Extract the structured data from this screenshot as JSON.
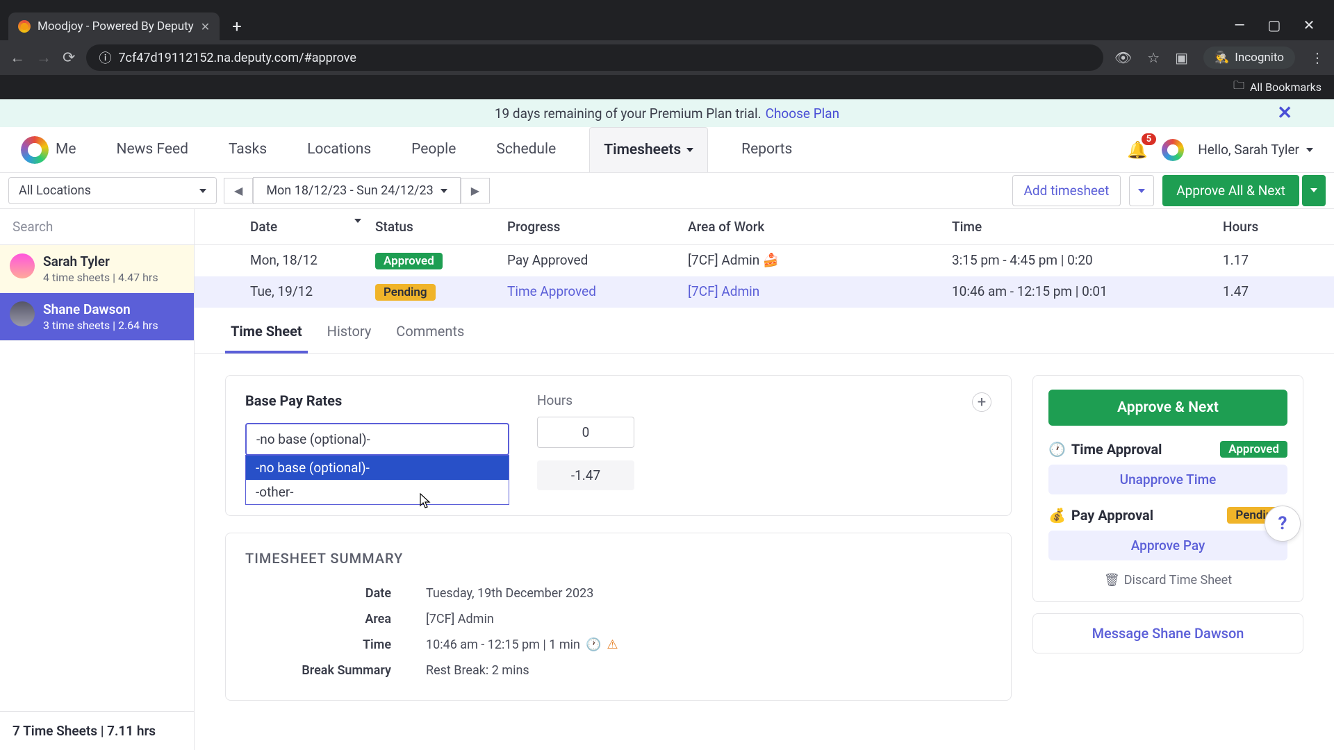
{
  "browser": {
    "tab_title": "Moodjoy - Powered By Deputy",
    "url": "7cf47d19112152.na.deputy.com/#approve",
    "incognito_label": "Incognito",
    "all_bookmarks": "All Bookmarks"
  },
  "banner": {
    "text": "19 days remaining of your Premium Plan trial.",
    "link": "Choose Plan"
  },
  "nav": {
    "items": [
      "Me",
      "News Feed",
      "Tasks",
      "Locations",
      "People",
      "Schedule",
      "Timesheets",
      "Reports"
    ],
    "active": "Timesheets",
    "notif_count": "5",
    "greeting": "Hello, Sarah Tyler"
  },
  "toolbar": {
    "location": "All Locations",
    "date_range": "Mon 18/12/23 - Sun 24/12/23",
    "add_timesheet": "Add timesheet",
    "approve_all": "Approve All & Next"
  },
  "sidebar": {
    "search_placeholder": "Search",
    "employees": [
      {
        "name": "Sarah Tyler",
        "meta": "4 time sheets | 4.47 hrs"
      },
      {
        "name": "Shane Dawson",
        "meta": "3 time sheets | 2.64 hrs"
      }
    ],
    "footer": "7 Time Sheets | 7.11 hrs"
  },
  "table": {
    "headers": {
      "date": "Date",
      "status": "Status",
      "progress": "Progress",
      "area": "Area of Work",
      "time": "Time",
      "hours": "Hours"
    },
    "rows": [
      {
        "date": "Mon, 18/12",
        "status": "Approved",
        "progress": "Pay Approved",
        "area": "[7CF] Admin 🍰",
        "time": "3:15 pm - 4:45 pm | 0:20",
        "hours": "1.17"
      },
      {
        "date": "Tue, 19/12",
        "status": "Pending",
        "progress": "Time Approved",
        "area": "[7CF] Admin",
        "time": "10:46 am - 12:15 pm | 0:01",
        "hours": "1.47"
      }
    ]
  },
  "tabs": {
    "items": [
      "Time Sheet",
      "History",
      "Comments"
    ]
  },
  "pay": {
    "title": "Base Pay Rates",
    "hours_label": "Hours",
    "value": "-no base (optional)-",
    "options": [
      "-no base (optional)-",
      "-other-"
    ],
    "hours": [
      "0",
      "-1.47"
    ]
  },
  "summary": {
    "title": "TIMESHEET SUMMARY",
    "rows": [
      {
        "label": "Date",
        "value": "Tuesday, 19th December 2023"
      },
      {
        "label": "Area",
        "value": "[7CF] Admin"
      },
      {
        "label": "Time",
        "value": "10:46 am - 12:15 pm | 1 min"
      },
      {
        "label": "Break Summary",
        "value": "Rest Break: 2 mins"
      }
    ]
  },
  "actions": {
    "approve_next": "Approve & Next",
    "time_approval": "Time Approval",
    "time_status": "Approved",
    "unapprove_time": "Unapprove Time",
    "pay_approval": "Pay Approval",
    "pay_status": "Pending",
    "approve_pay": "Approve Pay",
    "discard": "Discard Time Sheet",
    "message": "Message Shane Dawson"
  }
}
